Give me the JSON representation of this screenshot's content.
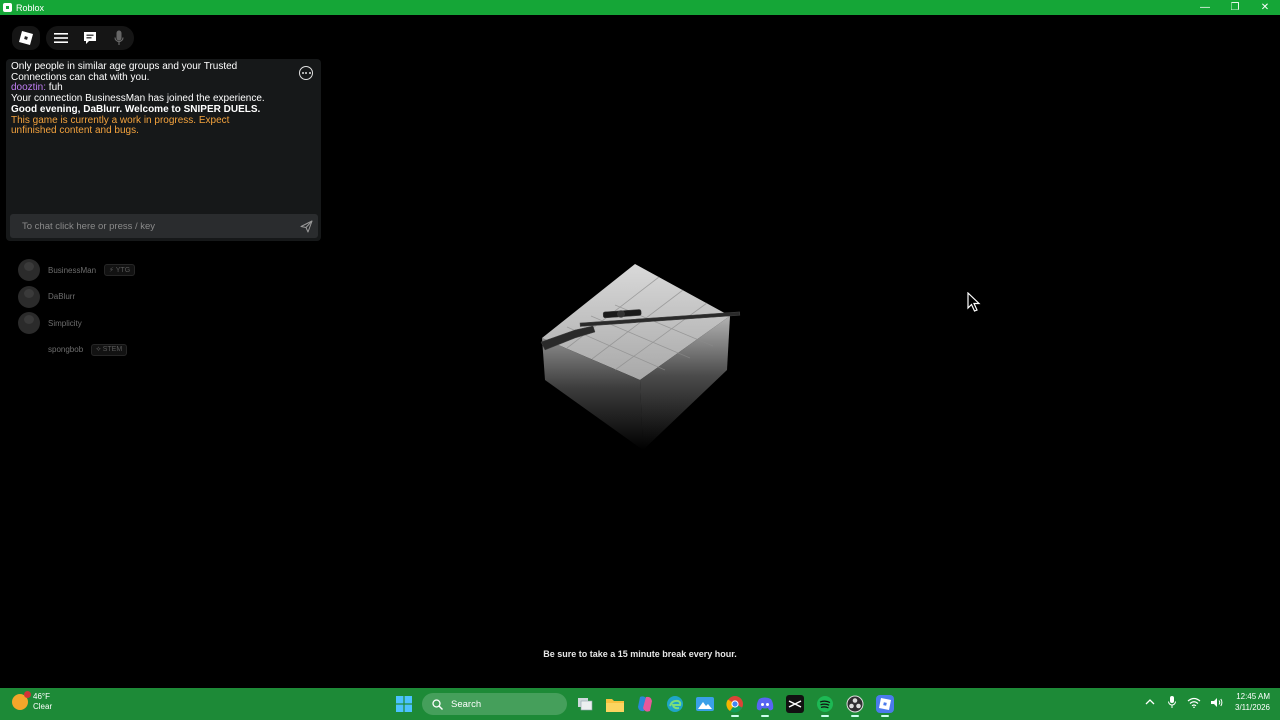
{
  "window": {
    "title": "Roblox"
  },
  "topbar": {
    "icons": [
      "roblox-logo-icon",
      "menu-icon",
      "chat-icon",
      "microphone-icon"
    ]
  },
  "chat": {
    "messages": {
      "system_notice": "Only people in similar age groups and your Trusted Connections can chat with you.",
      "user_name": "dooztin:",
      "user_text": " fuh",
      "join_notice": "Your connection BusinessMan has joined the experience.",
      "welcome": "Good evening, DaBlurr. Welcome to SNIPER DUELS.",
      "wip_notice": "This game is currently a work in progress. Expect unfinished content and bugs."
    },
    "input_placeholder": "To chat click here or press / key"
  },
  "players": [
    {
      "name": "BusinessMan",
      "badge": "⚡ YTG"
    },
    {
      "name": "DaBlurr",
      "badge": ""
    },
    {
      "name": "Simplicity",
      "badge": ""
    },
    {
      "name": "spongbob",
      "badge": "⟡ STEM"
    }
  ],
  "loading": {
    "tip": "Be sure to take a 15 minute break every hour."
  },
  "taskbar": {
    "weather": {
      "temp": "46°F",
      "condition": "Clear"
    },
    "search_label": "Search",
    "apps": [
      "windows-start-icon",
      "task-view-icon",
      "file-explorer-icon",
      "copilot-icon",
      "edge-icon",
      "photos-icon",
      "chrome-icon",
      "discord-icon",
      "capcut-icon",
      "spotify-icon",
      "obs-icon",
      "roblox-icon"
    ],
    "time": "12:45 AM",
    "date": "3/11/2026"
  },
  "colors": {
    "titlebar": "#15a637",
    "taskbar": "#1d8a37",
    "chat_name": "#c07ef5",
    "warning": "#f3a23d"
  }
}
